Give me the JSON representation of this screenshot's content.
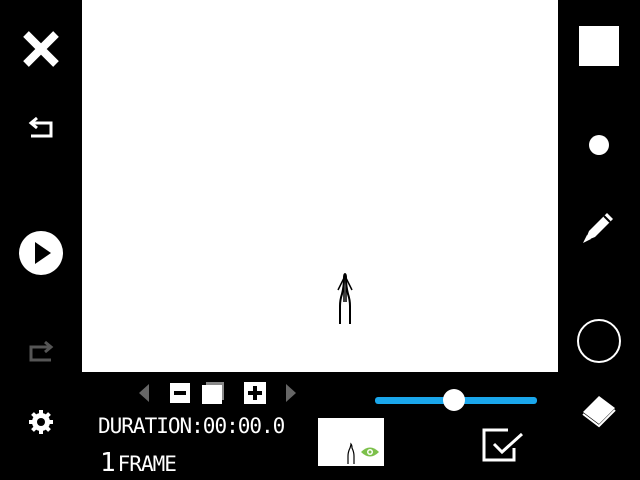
{
  "colors": {
    "accent": "#1aa7ec",
    "visibility": "#7cc04b",
    "background": "#000000",
    "canvas": "#ffffff"
  },
  "left_toolbar": [
    {
      "icon": "close-icon"
    },
    {
      "icon": "undo-icon"
    },
    {
      "icon": "play-icon"
    },
    {
      "icon": "redo-icon"
    },
    {
      "icon": "gear-icon"
    }
  ],
  "right_toolbar": [
    {
      "icon": "square-brush-icon"
    },
    {
      "icon": "brush-size-icon"
    },
    {
      "icon": "pen-icon"
    },
    {
      "icon": "color-circle-icon"
    },
    {
      "icon": "eraser-icon"
    }
  ],
  "frame_controls": [
    {
      "icon": "prev-frame-icon"
    },
    {
      "icon": "delete-frame-icon"
    },
    {
      "icon": "copy-frame-icon"
    },
    {
      "icon": "add-frame-icon"
    },
    {
      "icon": "next-frame-icon"
    }
  ],
  "timeline": {
    "duration_label": "DURATION:",
    "duration_value": "00:00.0",
    "frame_count": "1",
    "frame_label": "FRAME",
    "slider_value": 0.49
  },
  "thumbnail": {
    "icon": "eye-icon"
  },
  "confirm": {
    "icon": "confirm-check-icon"
  }
}
